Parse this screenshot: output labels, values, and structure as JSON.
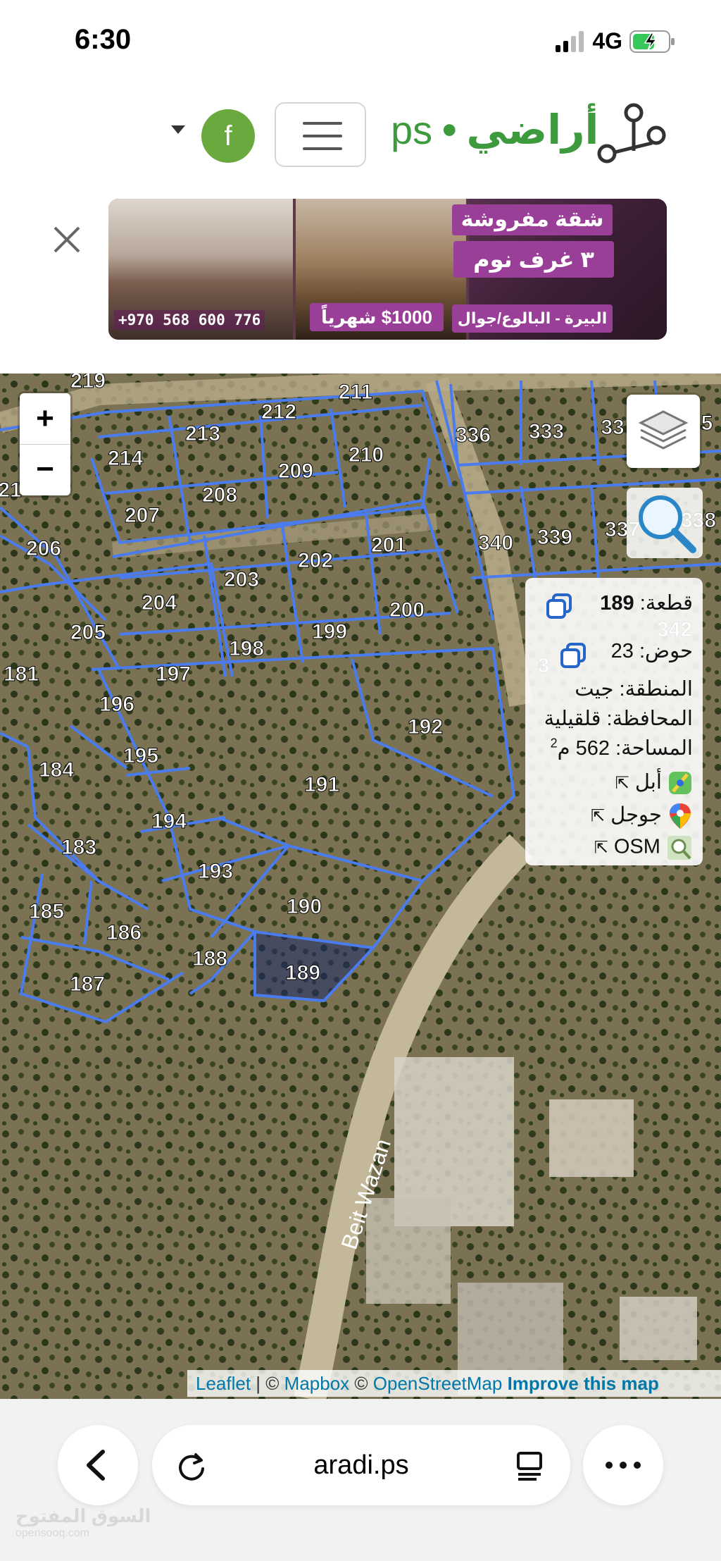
{
  "status_bar": {
    "time": "6:30",
    "network": "4G"
  },
  "header": {
    "brand_arabic": "أراضي",
    "brand_dot": "•",
    "brand_latin": "ps",
    "facebook_label": "f",
    "brand_color": "#3d9b3d"
  },
  "ad": {
    "line1": "شقة مفروشة",
    "line2": "٣ غرف نوم",
    "price": "$1000 شهرياً",
    "location": "البيرة - البالوع/جوال",
    "phone": "+970 568 600 776"
  },
  "map": {
    "zoom_in": "+",
    "zoom_out": "−",
    "street_label": "Beit Wazan",
    "parcels": [
      {
        "id": "219"
      },
      {
        "id": "211"
      },
      {
        "id": "212"
      },
      {
        "id": "213"
      },
      {
        "id": "214"
      },
      {
        "id": "210"
      },
      {
        "id": "209"
      },
      {
        "id": "208"
      },
      {
        "id": "207"
      },
      {
        "id": "206"
      },
      {
        "id": "21"
      },
      {
        "id": "336"
      },
      {
        "id": "333"
      },
      {
        "id": "33"
      },
      {
        "id": "5"
      },
      {
        "id": "340"
      },
      {
        "id": "339"
      },
      {
        "id": "337"
      },
      {
        "id": "338"
      },
      {
        "id": "203"
      },
      {
        "id": "202"
      },
      {
        "id": "201"
      },
      {
        "id": "204"
      },
      {
        "id": "205"
      },
      {
        "id": "200"
      },
      {
        "id": "199"
      },
      {
        "id": "198"
      },
      {
        "id": "197"
      },
      {
        "id": "196"
      },
      {
        "id": "181"
      },
      {
        "id": "192"
      },
      {
        "id": "191"
      },
      {
        "id": "195"
      },
      {
        "id": "194"
      },
      {
        "id": "184"
      },
      {
        "id": "183"
      },
      {
        "id": "193"
      },
      {
        "id": "190"
      },
      {
        "id": "185"
      },
      {
        "id": "186"
      },
      {
        "id": "188"
      },
      {
        "id": "189"
      },
      {
        "id": "187"
      },
      {
        "id": "342"
      },
      {
        "id": "3"
      }
    ],
    "selected_parcel": "189"
  },
  "info_panel": {
    "parcel_label": "قطعة:",
    "parcel_value": "189",
    "basin_label": "حوض:",
    "basin_value": "23",
    "region_label": "المنطقة:",
    "region_value": "جيت",
    "governorate_label": "المحافظة:",
    "governorate_value": "قلقيلية",
    "area_label": "المساحة:",
    "area_value": "562",
    "area_unit": "م",
    "area_exp": "2",
    "apple_link": "أبل",
    "google_link": "جوجل",
    "osm_link": "OSM"
  },
  "attribution": {
    "leaflet": "Leaflet",
    "sep": " | © ",
    "mapbox": "Mapbox",
    "copy2": " © ",
    "osm": "OpenStreetMap",
    "improve": "Improve this map"
  },
  "browser": {
    "url": "aradi.ps"
  },
  "watermark": {
    "text": "السوق المفتوح",
    "sub": "opensooq.com"
  }
}
